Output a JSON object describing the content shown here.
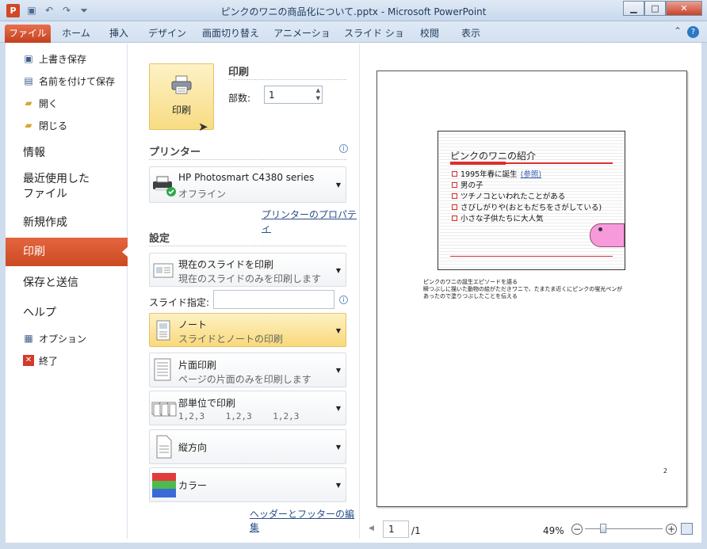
{
  "window": {
    "title": "ピンクのワニの商品化について.pptx - Microsoft PowerPoint",
    "app_icon_letter": "P",
    "controls": {
      "minimize": "▁",
      "maximize": "□",
      "close": "✕"
    }
  },
  "qat": {
    "save": "▣",
    "undo": "↶",
    "redo": "↷",
    "customize": "⏷"
  },
  "ribbon": {
    "tabs": [
      "ファイル",
      "ホーム",
      "挿入",
      "デザイン",
      "画面切り替え",
      "アニメーション",
      "スライド ショー",
      "校閲",
      "表示"
    ],
    "help": "?",
    "minimize_ribbon": "⌃"
  },
  "leftnav": {
    "small_top": [
      {
        "label": "上書き保存",
        "icon": "save-icon"
      },
      {
        "label": "名前を付けて保存",
        "icon": "save-as-icon"
      },
      {
        "label": "開く",
        "icon": "open-folder-icon"
      },
      {
        "label": "閉じる",
        "icon": "close-folder-icon"
      }
    ],
    "big": [
      "情報",
      "最近使用した\nファイル",
      "新規作成",
      "印刷",
      "保存と送信",
      "ヘルプ"
    ],
    "selected": "印刷",
    "small_bottom": [
      {
        "label": "オプション",
        "icon": "options-icon"
      },
      {
        "label": "終了",
        "icon": "exit-icon"
      }
    ]
  },
  "print": {
    "button_label": "印刷",
    "section_title": "印刷",
    "copies_label": "部数:",
    "copies_value": "1"
  },
  "printer": {
    "section_title": "プリンター",
    "name": "HP Photosmart C4380 series",
    "status": "オフライン",
    "properties_link": "プリンターのプロパティ"
  },
  "settings": {
    "section_title": "設定",
    "what": {
      "title": "現在のスライドを印刷",
      "subtitle": "現在のスライドのみを印刷します"
    },
    "range_label": "スライド指定:",
    "range_value": "",
    "layout": {
      "title": "ノート",
      "subtitle": "スライドとノートの印刷"
    },
    "sides": {
      "title": "片面印刷",
      "subtitle": "ページの片面のみを印刷します"
    },
    "collate": {
      "title": "部単位で印刷",
      "subtitle": "1,2,3    1,2,3    1,2,3"
    },
    "orientation": {
      "title": "縦方向"
    },
    "color": {
      "title": "カラー"
    },
    "header_footer_link": "ヘッダーとフッターの編集"
  },
  "preview": {
    "slide_title": "ピンクのワニの紹介",
    "bullets": [
      {
        "text": "1995年春に誕生",
        "link": "(参照)"
      },
      {
        "text": "男の子",
        "link": ""
      },
      {
        "text": "ツチノコといわれたことがある",
        "link": ""
      },
      {
        "text": "さびしがりや(おともだちをさがしている)",
        "link": ""
      },
      {
        "text": "小さな子供たちに大人気",
        "link": ""
      }
    ],
    "notes": [
      "ピンクのワニの誕生エピソードを語る",
      "瞬つぶしに描いた動物の絵がただきワニで、たまたま近くにピンクの蛍光ペンが",
      "あったので塗りつぶしたことを伝える"
    ],
    "page_number": "2"
  },
  "statusbar": {
    "page_current": "1",
    "page_total": "/1",
    "zoom": "49%"
  }
}
